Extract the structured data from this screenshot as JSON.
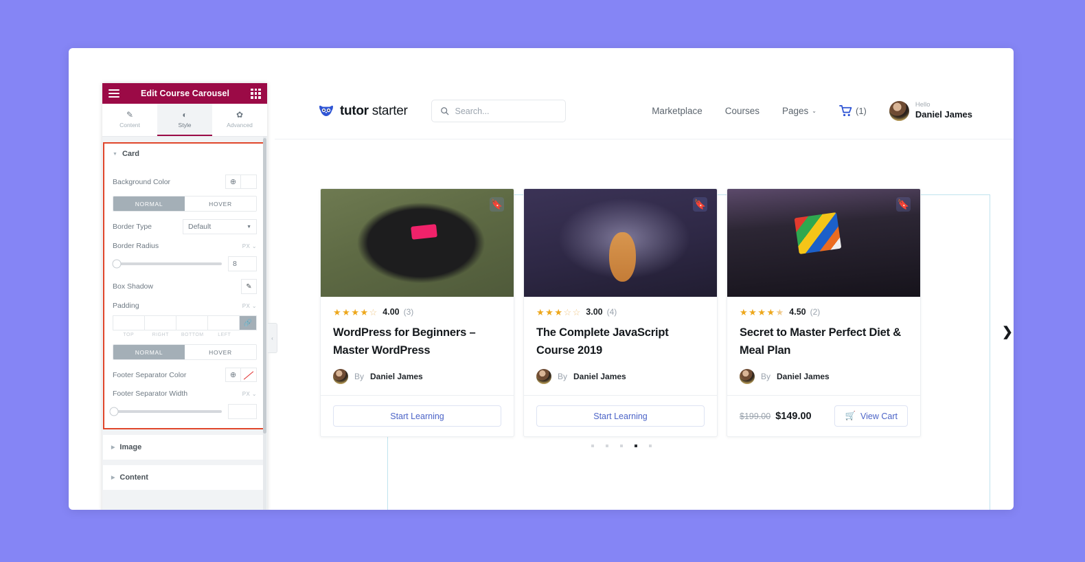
{
  "panel": {
    "title": "Edit Course Carousel",
    "menu_icon": "hamburger-icon",
    "grid_icon": "widgets-grid-icon",
    "tabs": [
      {
        "label": "Content",
        "icon": "pencil-icon",
        "glyph": "✎",
        "active": false
      },
      {
        "label": "Style",
        "icon": "contrast-icon",
        "glyph": "◐",
        "active": true
      },
      {
        "label": "Advanced",
        "icon": "gear-icon",
        "glyph": "✿",
        "active": false
      }
    ],
    "sections": [
      {
        "label": "Card",
        "expanded": true
      },
      {
        "label": "Image",
        "expanded": false
      },
      {
        "label": "Content",
        "expanded": false
      }
    ],
    "controls": {
      "background_color_label": "Background Color",
      "bg_state_normal": "NORMAL",
      "bg_state_hover": "HOVER",
      "border_type_label": "Border Type",
      "border_type_value": "Default",
      "border_radius_label": "Border Radius",
      "border_radius_unit": "PX",
      "border_radius_value": "8",
      "box_shadow_label": "Box Shadow",
      "box_shadow_icon": "pencil-icon",
      "padding_label": "Padding",
      "padding_unit": "PX",
      "padding_top": "",
      "padding_right": "",
      "padding_bottom": "",
      "padding_left": "",
      "padding_labels": [
        "TOP",
        "RIGHT",
        "BOTTOM",
        "LEFT"
      ],
      "padding_link_icon": "link-icon",
      "pad_state_normal": "NORMAL",
      "pad_state_hover": "HOVER",
      "footer_sep_color_label": "Footer Separator Color",
      "footer_sep_width_label": "Footer Separator Width",
      "footer_sep_width_unit": "PX",
      "footer_sep_width_value": ""
    },
    "collapse_toggle_icon": "chevron-left-icon"
  },
  "site_header": {
    "brand_bold": "tutor",
    "brand_light": " starter",
    "logo_icon": "owl-logo-icon",
    "search_placeholder": "Search...",
    "search_icon": "search-icon",
    "nav": [
      {
        "label": "Marketplace",
        "caret": false
      },
      {
        "label": "Courses",
        "caret": false
      },
      {
        "label": "Pages",
        "caret": true
      }
    ],
    "cart_icon": "shopping-cart-icon",
    "cart_count": "(1)",
    "user_greeting": "Hello",
    "user_name": "Daniel James",
    "user_avatar": "avatar"
  },
  "carousel": {
    "prev_icon": "chevron-left-icon",
    "next_icon": "chevron-right-icon",
    "dots_total": 5,
    "dots_active_index": 3,
    "cards": [
      {
        "thumb_class": "t1",
        "bookmark_icon": "bookmark-icon",
        "stars_filled": 4,
        "stars_half": 0,
        "rating_value": "4.00",
        "rating_count": "(3)",
        "title": "WordPress for Beginners – Master WordPress",
        "by_label": "By",
        "author": "Daniel James",
        "footer_type": "button",
        "button_label": "Start Learning",
        "button_icon": "",
        "price_old": "",
        "price_new": ""
      },
      {
        "thumb_class": "t2",
        "bookmark_icon": "bookmark-icon",
        "stars_filled": 3,
        "stars_half": 0,
        "rating_value": "3.00",
        "rating_count": "(4)",
        "title": "The Complete JavaScript Course 2019",
        "by_label": "By",
        "author": "Daniel James",
        "footer_type": "button",
        "button_label": "Start Learning",
        "button_icon": "",
        "price_old": "",
        "price_new": ""
      },
      {
        "thumb_class": "t3",
        "bookmark_icon": "bookmark-icon",
        "stars_filled": 4,
        "stars_half": 1,
        "rating_value": "4.50",
        "rating_count": "(2)",
        "title": "Secret to Master Perfect Diet & Meal Plan",
        "by_label": "By",
        "author": "Daniel James",
        "footer_type": "price",
        "button_label": "View Cart",
        "button_icon": "cart-icon",
        "price_old": "$199.00",
        "price_new": "$149.00"
      }
    ]
  },
  "colors": {
    "page_background": "#8585f5",
    "panel_header": "#9b0a46",
    "highlight_border": "#e0452a",
    "accent_link": "#4b63c7",
    "star": "#eda71c",
    "cart_blue": "#3c63e8"
  }
}
